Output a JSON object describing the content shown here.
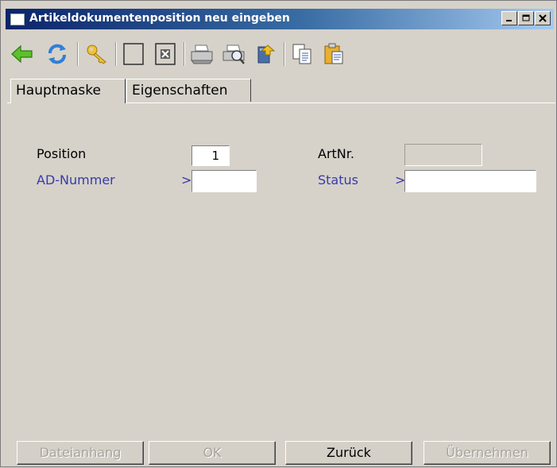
{
  "window": {
    "title": "Artikeldokumentenposition neu eingeben",
    "buttons": [
      "minimize",
      "maximize",
      "close"
    ]
  },
  "toolbar": {
    "icons": [
      "back-arrow-icon",
      "refresh-icon",
      "key-icon",
      "new-record-icon",
      "delete-record-icon",
      "print-icon",
      "print-preview-icon",
      "export-icon",
      "copy-icon",
      "paste-icon"
    ]
  },
  "tabs": [
    {
      "label": "Hauptmaske",
      "active": true
    },
    {
      "label": "Eigenschaften",
      "active": false
    }
  ],
  "form": {
    "position": {
      "label": "Position",
      "value": "1"
    },
    "ad_nummer": {
      "label": "AD-Nummer",
      "prefix": ">",
      "value": ""
    },
    "artnr": {
      "label": "ArtNr.",
      "value": ""
    },
    "status": {
      "label": "Status",
      "prefix": ">",
      "value": ""
    }
  },
  "buttons": {
    "dateianhang": {
      "label": "Dateianhang",
      "enabled": false
    },
    "ok": {
      "label": "OK",
      "enabled": false
    },
    "zurueck": {
      "label": "Zurück",
      "enabled": true
    },
    "uebernehmen": {
      "label": "Übernehmen",
      "enabled": false
    }
  },
  "colors": {
    "title_gradient_start": "#0a246a",
    "title_gradient_end": "#a6caf0",
    "link_label": "#3a3aa8",
    "dialog_bg": "#d6d2ca"
  }
}
